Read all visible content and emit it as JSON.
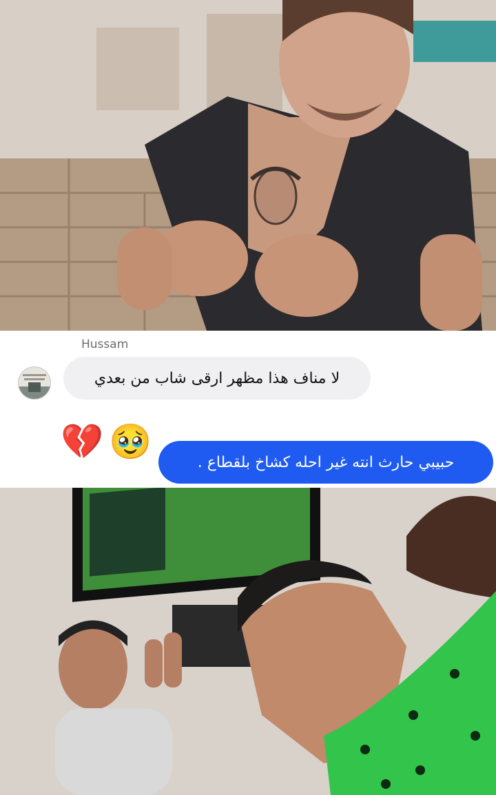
{
  "message_in": {
    "sender": "Hussam",
    "text": "لا مناف هذا مظهر ارقى شاب من بعدي"
  },
  "reaction": {
    "emojis": [
      "💔",
      "🥹"
    ]
  },
  "message_out": {
    "text": "حبيبي حارث انته غير احله كشاخ بلقطاع ."
  },
  "colors": {
    "outgoing_bubble": "#1f5bf0",
    "incoming_bubble": "#f0f0f2"
  }
}
